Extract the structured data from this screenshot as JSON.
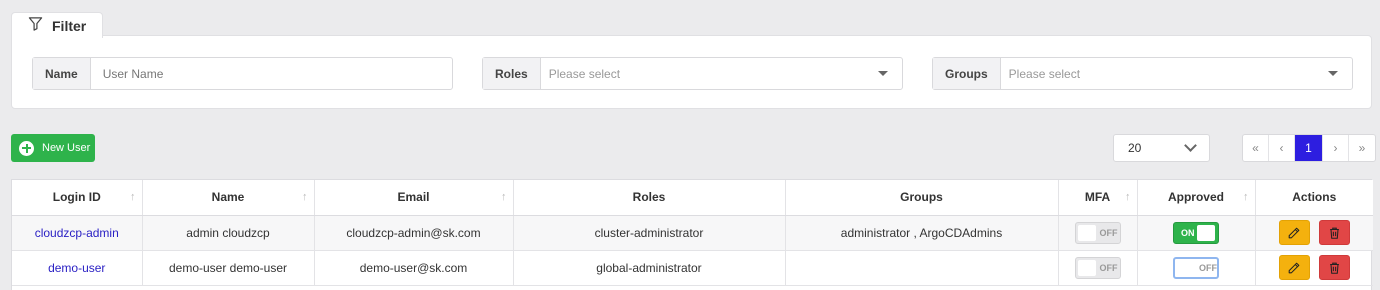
{
  "filter": {
    "tab_label": "Filter",
    "name_label": "Name",
    "name_placeholder": "User Name",
    "roles_label": "Roles",
    "roles_placeholder": "Please select",
    "groups_label": "Groups",
    "groups_placeholder": "Please select"
  },
  "toolbar": {
    "new_user_label": "New User",
    "page_size": "20"
  },
  "pagination": {
    "first": "«",
    "prev": "‹",
    "current": "1",
    "next": "›",
    "last": "»"
  },
  "table": {
    "columns": [
      "Login ID",
      "Name",
      "Email",
      "Roles",
      "Groups",
      "MFA",
      "Approved",
      "Actions"
    ],
    "sort_glyph": "↑",
    "rows": [
      {
        "login_id": "cloudzcp-admin",
        "name": "admin cloudzcp",
        "email": "cloudzcp-admin@sk.com",
        "roles": "cluster-administrator",
        "groups": "administrator , ArgoCDAdmins",
        "mfa": "OFF",
        "approved": "ON"
      },
      {
        "login_id": "demo-user",
        "name": "demo-user demo-user",
        "email": "demo-user@sk.com",
        "roles": "global-administrator",
        "groups": "",
        "mfa": "OFF",
        "approved": "OFF"
      }
    ]
  },
  "icons": {
    "filter": "filter-funnel-icon",
    "new_user": "plus-circle-icon",
    "edit": "pencil-icon",
    "delete": "trash-icon",
    "dropdown": "chevron-down-icon"
  },
  "colors": {
    "primary": "#2d1ee0",
    "success": "#2eb34b",
    "warning": "#f4b10e",
    "danger": "#e14646",
    "link": "#2b21c4"
  }
}
